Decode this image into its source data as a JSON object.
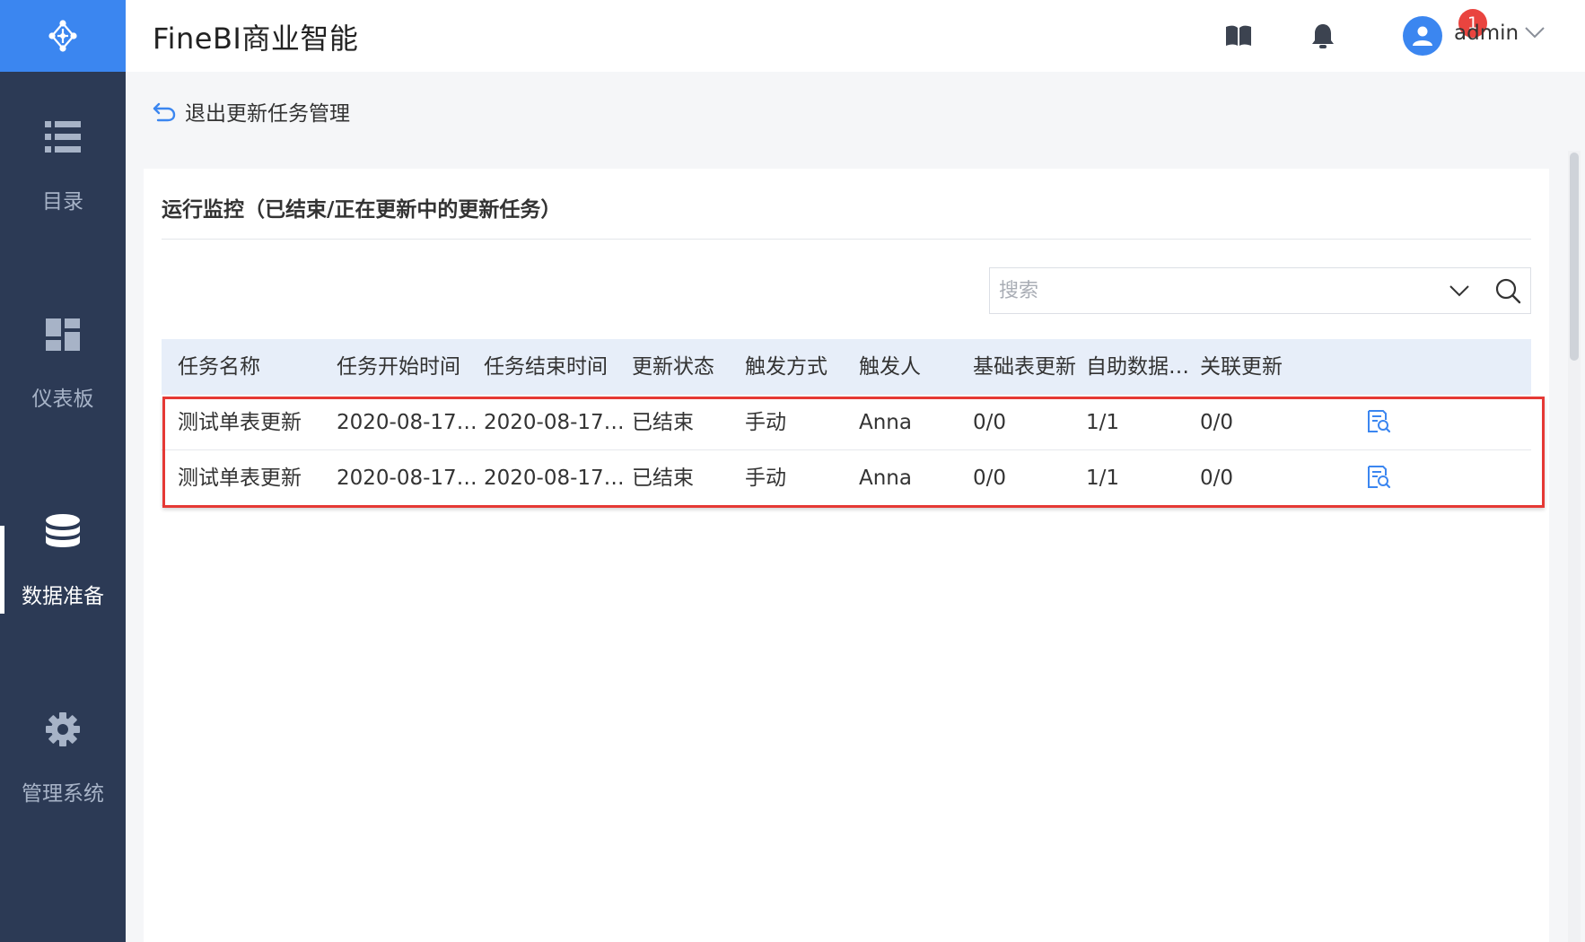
{
  "app": {
    "title": "FineBI商业智能"
  },
  "sidebar": {
    "items": [
      {
        "label": "目录",
        "icon": "list-icon",
        "active": false
      },
      {
        "label": "仪表板",
        "icon": "dashboard-icon",
        "active": false
      },
      {
        "label": "数据准备",
        "icon": "database-icon",
        "active": true
      },
      {
        "label": "管理系统",
        "icon": "gear-icon",
        "active": false
      }
    ]
  },
  "header": {
    "notification_count": "1",
    "user_name": "admin",
    "icons": [
      "book-icon",
      "bell-icon",
      "user-icon",
      "chevron-down-icon"
    ]
  },
  "main": {
    "back_label": "退出更新任务管理",
    "panel_title": "运行监控（已结束/正在更新中的更新任务）",
    "search": {
      "placeholder": "搜索",
      "value": ""
    },
    "table": {
      "columns": [
        "任务名称",
        "任务开始时间",
        "任务结束时间",
        "更新状态",
        "触发方式",
        "触发人",
        "基础表更新",
        "自助数据…",
        "关联更新"
      ],
      "rows": [
        [
          "测试单表更新",
          "2020-08-17 …",
          "2020-08-17 …",
          "已结束",
          "手动",
          "Anna",
          "0/0",
          "1/1",
          "0/0"
        ],
        [
          "测试单表更新",
          "2020-08-17 …",
          "2020-08-17 …",
          "已结束",
          "手动",
          "Anna",
          "0/0",
          "1/1",
          "0/0"
        ]
      ]
    }
  },
  "colors": {
    "sidebar_bg": "#2c3a55",
    "brand_blue": "#3b86f0",
    "table_header_bg": "#e7eef9",
    "highlight_red": "#e53935",
    "badge_red": "#e9443f"
  }
}
